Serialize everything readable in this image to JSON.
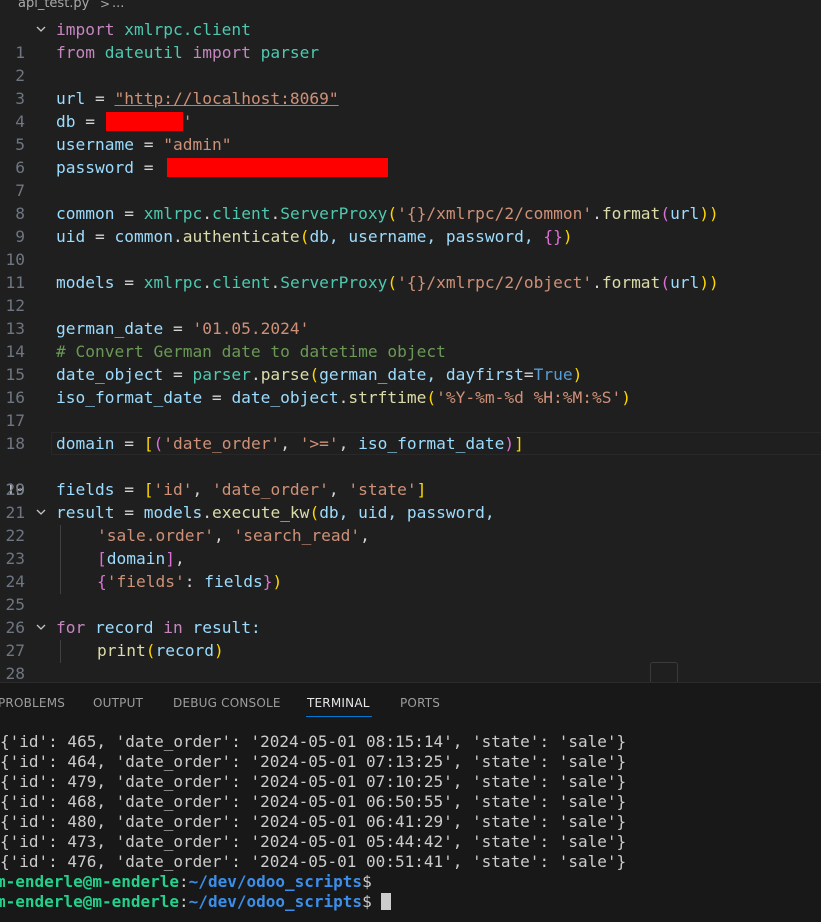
{
  "breadcrumb": {
    "file": "api_test.py",
    "separator": ">",
    "more": "..."
  },
  "editor": {
    "active_line": 19,
    "lines": {
      "l1": {
        "n": "1",
        "a": "import",
        "b": " xmlrpc.client"
      },
      "l2": {
        "n": "2",
        "a": "from",
        "b": " dateutil ",
        "c": "import",
        "d": " parser"
      },
      "l3": {
        "n": "3"
      },
      "l4": {
        "n": "4",
        "a": "url",
        "b": " = ",
        "c": "\"http://localhost:8069\""
      },
      "l5": {
        "n": "5",
        "a": "db",
        "b": " = ",
        "c": "'"
      },
      "l6": {
        "n": "6",
        "a": "username",
        "b": " = ",
        "c": "\"admin\""
      },
      "l7": {
        "n": "7",
        "a": "password",
        "b": " = "
      },
      "l8": {
        "n": "8"
      },
      "l9": {
        "n": "9",
        "a": "common",
        "b": " = ",
        "c": "xmlrpc",
        "d": ".",
        "e": "client",
        "f": ".",
        "g": "ServerProxy",
        "h": "(",
        "i": "'{}/xmlrpc/2/common'",
        "j": ".",
        "k": "format",
        "l": "(",
        "m": "url",
        "o": "))"
      },
      "l10": {
        "n": "10",
        "a": "uid",
        "b": " = ",
        "c": "common",
        "d": ".",
        "e": "authenticate",
        "f": "(",
        "g": "db, username, password, ",
        "h": "{}",
        "i": ")"
      },
      "l11": {
        "n": "11"
      },
      "l12": {
        "n": "12",
        "a": "models",
        "b": " = ",
        "c": "xmlrpc",
        "d": ".",
        "e": "client",
        "f": ".",
        "g": "ServerProxy",
        "h": "(",
        "i": "'{}/xmlrpc/2/object'",
        "j": ".",
        "k": "format",
        "l": "(",
        "m": "url",
        "o": "))"
      },
      "l13": {
        "n": "13"
      },
      "l14": {
        "n": "14",
        "a": "german_date",
        "b": " = ",
        "c": "'01.05.2024'"
      },
      "l15": {
        "n": "15",
        "a": "# Convert German date to datetime object"
      },
      "l16": {
        "n": "16",
        "a": "date_object",
        "b": " = ",
        "c": "parser",
        "d": ".",
        "e": "parse",
        "f": "(",
        "g": "german_date, ",
        "h": "dayfirst",
        "i": "=",
        "j": "True",
        "k": ")"
      },
      "l17": {
        "n": "17",
        "a": "iso_format_date",
        "b": " = ",
        "c": "date_object",
        "d": ".",
        "e": "strftime",
        "f": "(",
        "g": "'%Y-%m-%d %H:%M:%S'",
        "h": ")"
      },
      "l18": {
        "n": "18"
      },
      "l19": {
        "n": "19",
        "a": "domain",
        "b": " = ",
        "c": "[",
        "d": "(",
        "e": "'date_order'",
        "f": ", ",
        "g": "'>='",
        "h": ", ",
        "i": "iso_format_date",
        "j": ")",
        "k": "]"
      },
      "l20": {
        "n": "20"
      },
      "l21": {
        "n": "21",
        "a": "fields",
        "b": " = ",
        "c": "[",
        "d": "'id'",
        "e": ", ",
        "f": "'date_order'",
        "g": ", ",
        "h": "'state'",
        "i": "]"
      },
      "l22": {
        "n": "22",
        "a": "result",
        "b": " = ",
        "c": "models",
        "d": ".",
        "e": "execute_kw",
        "f": "(",
        "g": "db, uid, password,"
      },
      "l23": {
        "n": "23",
        "a": "'sale.order'",
        "b": ", ",
        "c": "'search_read'",
        "d": ","
      },
      "l24": {
        "n": "24",
        "a": "[",
        "b": "domain",
        "c": "]",
        "d": ","
      },
      "l25": {
        "n": "25",
        "a": "{",
        "b": "'fields'",
        "c": ": ",
        "d": "fields",
        "e": "}",
        "f": ")"
      },
      "l26": {
        "n": "26"
      },
      "l27": {
        "n": "27",
        "a": "for",
        "b": " record ",
        "c": "in",
        "d": " result:"
      },
      "l28": {
        "n": "28",
        "a": "print",
        "b": "(",
        "c": "record",
        "d": ")"
      }
    }
  },
  "panel": {
    "tabs": {
      "problems": "PROBLEMS",
      "output": "OUTPUT",
      "debug": "DEBUG CONSOLE",
      "terminal": "TERMINAL",
      "ports": "PORTS"
    },
    "terminal_output": [
      "{'id': 465, 'date_order': '2024-05-01 08:15:14', 'state': 'sale'}",
      "{'id': 464, 'date_order': '2024-05-01 07:13:25', 'state': 'sale'}",
      "{'id': 479, 'date_order': '2024-05-01 07:10:25', 'state': 'sale'}",
      "{'id': 468, 'date_order': '2024-05-01 06:50:55', 'state': 'sale'}",
      "{'id': 480, 'date_order': '2024-05-01 06:41:29', 'state': 'sale'}",
      "{'id': 473, 'date_order': '2024-05-01 05:44:42', 'state': 'sale'}",
      "{'id': 476, 'date_order': '2024-05-01 00:51:41', 'state': 'sale'}"
    ],
    "prompt": {
      "user": "m-enderle@m-enderle",
      "colon": ":",
      "path": "~/dev/odoo_scripts",
      "symbol": "$"
    }
  },
  "colors": {
    "background": "#1f1f1f",
    "panel_background": "#181818",
    "keyword": "#c586c0",
    "string": "#ce9178",
    "function": "#dcdcaa",
    "variable": "#9cdcfe",
    "class": "#4ec9b0",
    "comment": "#6a9955",
    "accent": "#0078d4",
    "prompt_user": "#23d18b",
    "prompt_path": "#3b8eea",
    "redaction": "#ff0000"
  }
}
